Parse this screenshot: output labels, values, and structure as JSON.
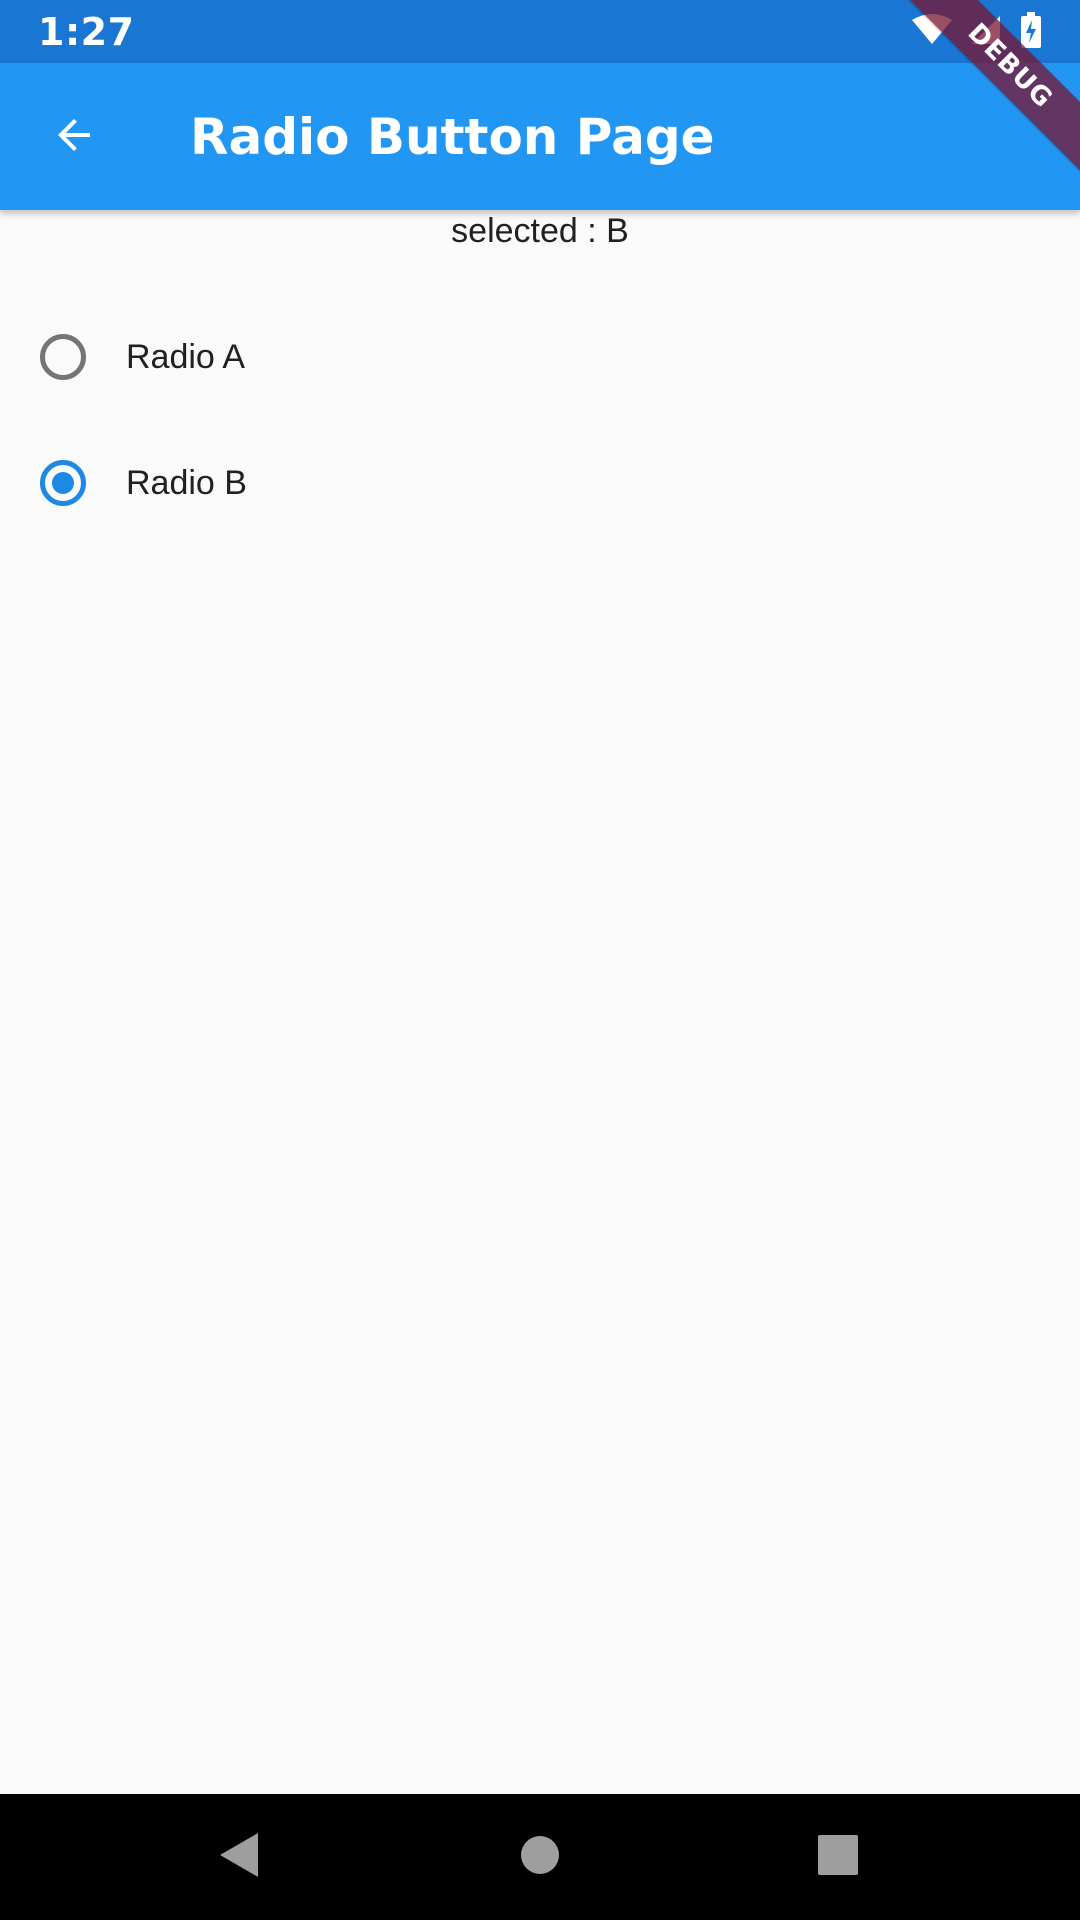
{
  "status_bar": {
    "time": "1:27",
    "icons": [
      "wifi-icon",
      "cell-signal-icon",
      "battery-icon"
    ]
  },
  "debug_banner": {
    "label": "DEBUG",
    "color": "#7a1432"
  },
  "app_bar": {
    "title": "Radio Button Page",
    "back_icon": "arrow-back-icon",
    "color": "#2196f3"
  },
  "content": {
    "selected_text": "selected : B",
    "radios": [
      {
        "label": "Radio A",
        "selected": false
      },
      {
        "label": "Radio B",
        "selected": true
      }
    ],
    "accent_color": "#1e88e5"
  },
  "nav_bar": {
    "icons": [
      "nav-back-icon",
      "nav-home-icon",
      "nav-recents-icon"
    ]
  }
}
